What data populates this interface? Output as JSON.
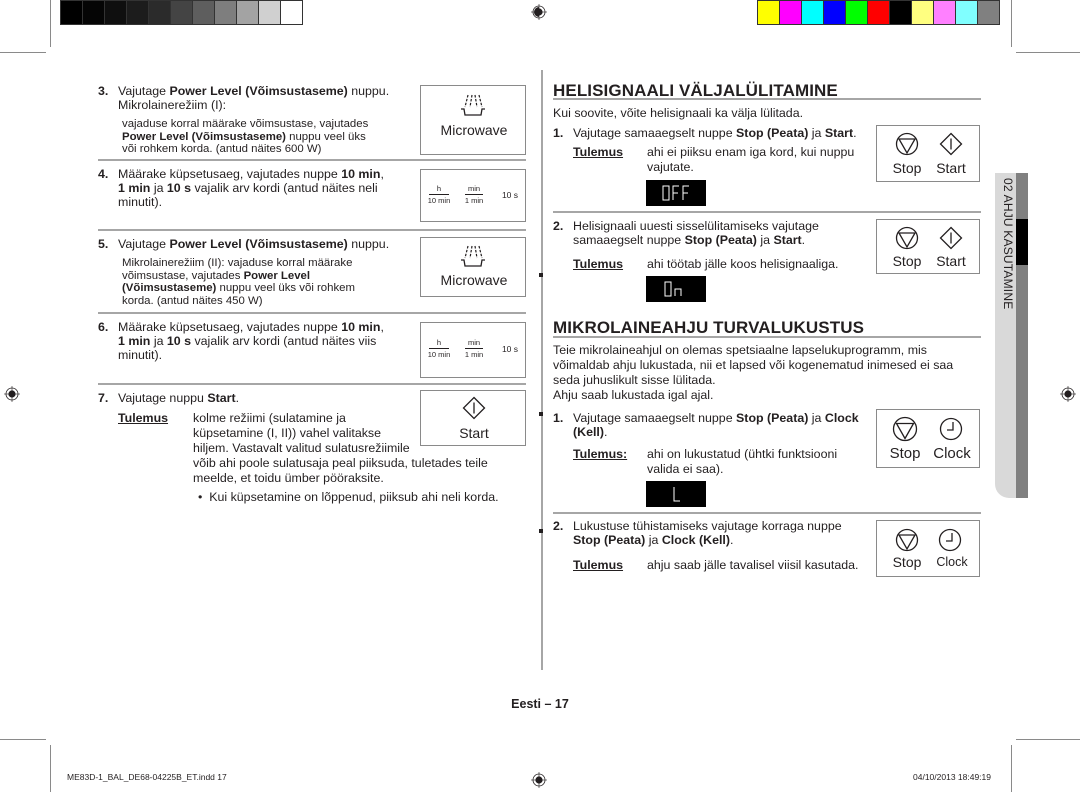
{
  "color_bars": {
    "grayscale": [
      "#000000",
      "#050505",
      "#0f0f0f",
      "#1c1c1c",
      "#2b2b2b",
      "#444444",
      "#5e5e5e",
      "#7e7e7e",
      "#a3a3a3",
      "#d0d0d0",
      "#ffffff"
    ],
    "process": [
      "#ffff00",
      "#ff00ff",
      "#00ffff",
      "#0000ff",
      "#00ff00",
      "#ff0000",
      "#000000",
      "#ffff80",
      "#ff80ff",
      "#80ffff",
      "#808080"
    ]
  },
  "left": {
    "step3": {
      "num": "3.",
      "line1_pre": "Vajutage ",
      "line1_bold": "Power Level (Võimsustaseme)",
      "line1_post": " nuppu.",
      "line2": "Mikrolainerežiim (I):",
      "sub1": "vajaduse korral määrake võimsustase, vajutades",
      "sub2_bold": "Power Level (Võimsustaseme)",
      "sub2_post": " nuppu veel üks",
      "sub3": "või rohkem korda. (antud näites 600 W)",
      "panel_label": "Microwave"
    },
    "step4": {
      "num": "4.",
      "l1_pre": "Määrake küpsetusaeg, vajutades nuppe ",
      "l1_bold": "10 min",
      "l1_post": ",",
      "l2_b1": "1 min",
      "l2_mid": " ja ",
      "l2_b2": "10 s",
      "l2_post": " vajalik arv kordi (antud näites neli",
      "l3": "minutit).",
      "timer": {
        "top1": "h",
        "bot1": "10 min",
        "top2": "min",
        "bot2": "1 min",
        "s": "10 s"
      }
    },
    "step5": {
      "num": "5.",
      "line1_pre": "Vajutage ",
      "line1_bold": "Power Level (Võimsustaseme)",
      "line1_post": " nuppu.",
      "sub1": "Mikrolainerežiim (II): vajaduse korral määrake",
      "sub2_pre": "võimsustase, vajutades ",
      "sub2_bold": "Power Level",
      "sub3_bold": "(Võimsustaseme)",
      "sub3_post": " nuppu veel üks või rohkem",
      "sub4": "korda. (antud näites 450 W)",
      "panel_label": "Microwave"
    },
    "step6": {
      "num": "6.",
      "l1_pre": "Määrake küpsetusaeg, vajutades nuppe ",
      "l1_bold": "10 min",
      "l1_post": ",",
      "l2_b1": "1 min",
      "l2_mid": " ja ",
      "l2_b2": "10 s",
      "l2_post": " vajalik arv kordi (antud näites viis",
      "l3": "minutit).",
      "timer": {
        "top1": "h",
        "bot1": "10 min",
        "top2": "min",
        "bot2": "1 min",
        "s": "10 s"
      }
    },
    "step7": {
      "num": "7.",
      "line1_pre": "Vajutage nuppu ",
      "line1_bold": "Start",
      "line1_post": ".",
      "result_label": "Tulemus",
      "r1": "kolme režiimi (sulatamine ja",
      "r2": "küpsetamine (I, II)) vahel valitakse",
      "r3": "hiljem. Vastavalt valitud sulatusrežiimile",
      "r4": "võib ahi poole sulatusaja peal piiksuda, tuletades teile",
      "r5": "meelde, et toidu ümber pööraksite.",
      "bullet": "Kui küpsetamine on lõppenud, piiksub ahi neli korda.",
      "panel_label": "Start"
    }
  },
  "right": {
    "section1": {
      "title": "HELISIGNAALI VÄLJALÜLITAMINE",
      "intro": "Kui soovite, võite helisignaali ka välja lülitada.",
      "step1": {
        "num": "1.",
        "pre": "Vajutage samaaegselt nuppe ",
        "b1": "Stop (Peata)",
        "mid": " ja ",
        "b2": "Start",
        "post": ".",
        "result_label": "Tulemus",
        "r1": "ahi ei piiksu enam iga kord, kui nuppu",
        "r2": "vajutate.",
        "display": "OFF",
        "btn1": "Stop",
        "btn2": "Start"
      },
      "step2": {
        "num": "2.",
        "l1": "Helisignaali uuesti sisselülitamiseks vajutage",
        "l2_pre": "samaaegselt nuppe ",
        "b1": "Stop (Peata)",
        "mid": " ja ",
        "b2": "Start",
        "post": ".",
        "result_label": "Tulemus",
        "r1": "ahi töötab jälle koos helisignaaliga.",
        "display": "On",
        "btn1": "Stop",
        "btn2": "Start"
      }
    },
    "section2": {
      "title": "MIKROLAINEAHJU TURVALUKUSTUS",
      "p1": "Teie mikrolaineahjul on olemas spetsiaalne lapselukuprogramm, mis",
      "p2": "võimaldab ahju lukustada, nii et lapsed või kogenematud inimesed ei saa",
      "p3": "seda juhuslikult sisse lülitada.",
      "p4": "Ahju saab lukustada igal ajal.",
      "step1": {
        "num": "1.",
        "pre": "Vajutage samaaegselt nuppe ",
        "b1": "Stop (Peata)",
        "mid": " ja ",
        "b2": "Clock",
        "l2_bold": "(Kell)",
        "l2_post": ".",
        "result_label": "Tulemus:",
        "r1": "ahi on lukustatud (ühtki funktsiooni",
        "r2": "valida ei saa).",
        "display": "L",
        "btn1": "Stop",
        "btn2": "Clock"
      },
      "step2": {
        "num": "2.",
        "l1": "Lukustuse tühistamiseks vajutage korraga nuppe",
        "b1": "Stop (Peata)",
        "mid": " ja ",
        "b2": "Clock (Kell)",
        "post": ".",
        "result_label": "Tulemus",
        "r1": "ahju saab jälle tavalisel viisil kasutada.",
        "btn1": "Stop",
        "btn2": "Clock"
      }
    }
  },
  "side_tab": {
    "label": "02  AHJU KASUTAMINE"
  },
  "footer": {
    "page": "Eesti – 17",
    "file": "ME83D-1_BAL_DE68-04225B_ET.indd   17",
    "timestamp": "04/10/2013   18:49:19"
  }
}
